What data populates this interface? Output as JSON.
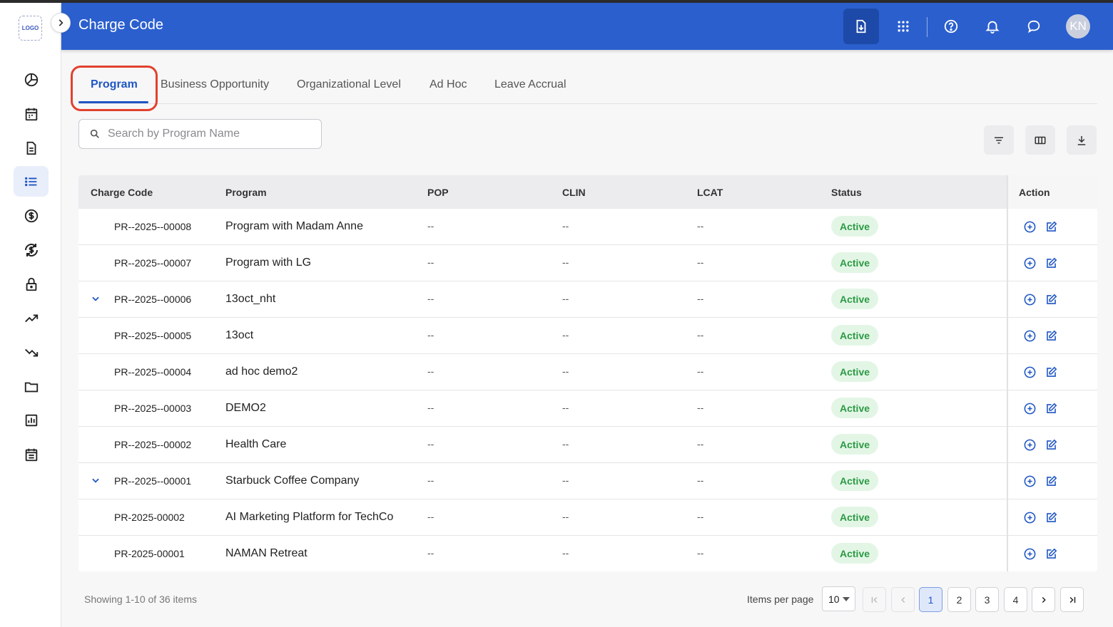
{
  "app": {
    "logo_text": "LOGO",
    "title": "Charge Code",
    "user_initials": "KN"
  },
  "sidebar": {
    "items": [
      {
        "icon": "pie-chart-icon"
      },
      {
        "icon": "calendar-icon"
      },
      {
        "icon": "document-icon"
      },
      {
        "icon": "list-icon",
        "active": true
      },
      {
        "icon": "dollar-icon"
      },
      {
        "icon": "dollar-sync-icon"
      },
      {
        "icon": "lock-icon"
      },
      {
        "icon": "trending-up-icon"
      },
      {
        "icon": "trending-down-icon"
      },
      {
        "icon": "folder-icon"
      },
      {
        "icon": "report-chart-icon"
      },
      {
        "icon": "schedule-icon"
      }
    ]
  },
  "tabs": [
    {
      "label": "Program",
      "active": true
    },
    {
      "label": "Business Opportunity"
    },
    {
      "label": "Organizational Level"
    },
    {
      "label": "Ad Hoc"
    },
    {
      "label": "Leave Accrual"
    }
  ],
  "search": {
    "placeholder": "Search by Program Name",
    "value": ""
  },
  "table": {
    "columns": [
      "Charge Code",
      "Program",
      "POP",
      "CLIN",
      "LCAT",
      "Status",
      "Action"
    ],
    "rows": [
      {
        "code": "PR--2025--00008",
        "program": "Program with Madam Anne",
        "pop": "--",
        "clin": "--",
        "lcat": "--",
        "status": "Active",
        "expandable": false
      },
      {
        "code": "PR--2025--00007",
        "program": "Program with LG",
        "pop": "--",
        "clin": "--",
        "lcat": "--",
        "status": "Active",
        "expandable": false
      },
      {
        "code": "PR--2025--00006",
        "program": "13oct_nht",
        "pop": "--",
        "clin": "--",
        "lcat": "--",
        "status": "Active",
        "expandable": true
      },
      {
        "code": "PR--2025--00005",
        "program": "13oct",
        "pop": "--",
        "clin": "--",
        "lcat": "--",
        "status": "Active",
        "expandable": false
      },
      {
        "code": "PR--2025--00004",
        "program": "ad hoc demo2",
        "pop": "--",
        "clin": "--",
        "lcat": "--",
        "status": "Active",
        "expandable": false
      },
      {
        "code": "PR--2025--00003",
        "program": "DEMO2",
        "pop": "--",
        "clin": "--",
        "lcat": "--",
        "status": "Active",
        "expandable": false
      },
      {
        "code": "PR--2025--00002",
        "program": "Health Care",
        "pop": "--",
        "clin": "--",
        "lcat": "--",
        "status": "Active",
        "expandable": false
      },
      {
        "code": "PR--2025--00001",
        "program": "Starbuck Coffee Company",
        "pop": "--",
        "clin": "--",
        "lcat": "--",
        "status": "Active",
        "expandable": true
      },
      {
        "code": "PR-2025-00002",
        "program": "AI Marketing Platform for TechCo",
        "pop": "--",
        "clin": "--",
        "lcat": "--",
        "status": "Active",
        "expandable": false
      },
      {
        "code": "PR-2025-00001",
        "program": "NAMAN Retreat",
        "pop": "--",
        "clin": "--",
        "lcat": "--",
        "status": "Active",
        "expandable": false
      }
    ]
  },
  "footer": {
    "showing": "Showing 1-10 of 36 items",
    "items_per_page_label": "Items per page",
    "items_per_page": "10",
    "pages": [
      "1",
      "2",
      "3",
      "4"
    ],
    "current_page": "1"
  },
  "colors": {
    "header_bg": "#2b5fce",
    "accent": "#1f56c4",
    "status_active_bg": "#e3f6e6",
    "status_active_text": "#2c9a44",
    "highlight_box": "#e2412f"
  }
}
